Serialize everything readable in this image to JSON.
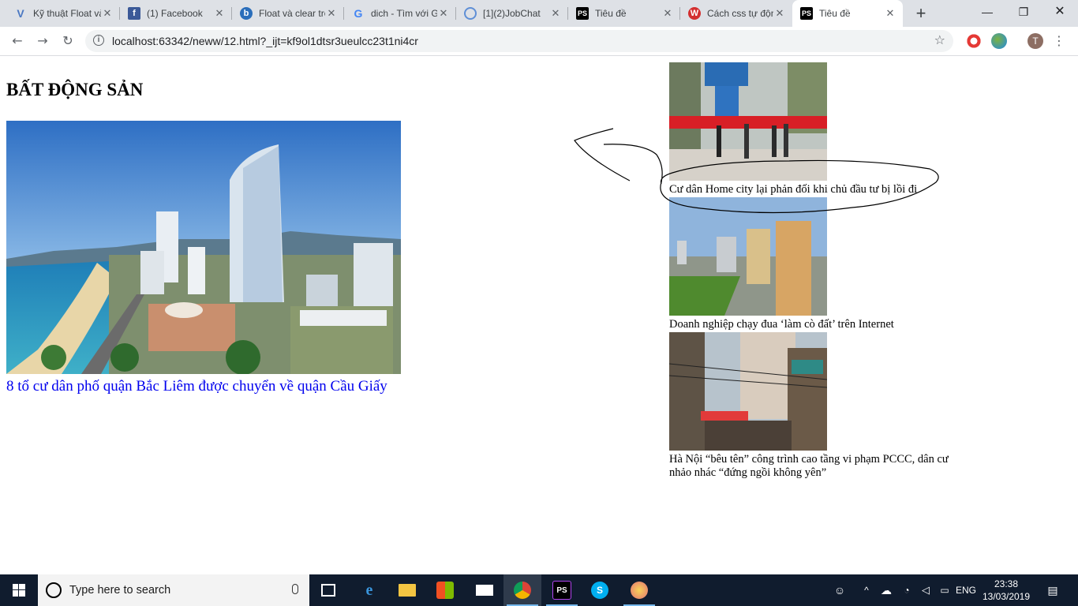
{
  "browser": {
    "tabs": [
      {
        "title": "Kỹ thuật Float và clear",
        "icon": "v-icon",
        "color": "#4a78c2"
      },
      {
        "title": "(1) Facebook",
        "icon": "facebook-icon",
        "color": "#3b5998"
      },
      {
        "title": "Float và clear trong CSS",
        "icon": "bing-icon",
        "color": "#2a6ebb"
      },
      {
        "title": "dich - Tìm với Google",
        "icon": "google-icon",
        "color": "#4285f4"
      },
      {
        "title": "[1](2)JobChat",
        "icon": "jobchat-icon",
        "color": "#5f8fd6"
      },
      {
        "title": "Tiêu đề",
        "icon": "phpstorm-icon",
        "color": "#000000"
      },
      {
        "title": "Cách css tự động",
        "icon": "w-icon",
        "color": "#d32f2f"
      },
      {
        "title": "Tiêu đề",
        "icon": "phpstorm-icon",
        "color": "#000000",
        "active": true
      }
    ],
    "new_tab": "+",
    "url": "localhost:63342/neww/12.html?_ijt=kf9ol1dtsr3ueulcc23t1ni4cr",
    "profile_initial": "T"
  },
  "page": {
    "section_title": "BẤT ĐỘNG SẢN",
    "main_article": {
      "title": "8 tổ cư dân phố quận Bắc Liêm được chuyển về quận Cầu Giấy",
      "image": "city-coastline-photo"
    },
    "side_articles": [
      {
        "title": "Cư dân Home city lại phản đối khi chủ đầu tư bị lồi đi",
        "image": "protest-banner-photo"
      },
      {
        "title": "Doanh nghiệp chạy đua ‘làm cò đất’ trên Internet",
        "image": "apartment-towers-photo"
      },
      {
        "title": "Hà Nội “bêu tên” công trình cao tầng vi phạm PCCC, dân cư nhảo nhác “đứng ngồi không yên”",
        "image": "street-buildings-photo"
      }
    ]
  },
  "taskbar": {
    "search_placeholder": "Type here to search",
    "language": "ENG",
    "time": "23:38",
    "date": "13/03/2019",
    "apps": [
      "task-view-icon",
      "edge-icon",
      "file-explorer-icon",
      "store-icon",
      "mail-icon",
      "chrome-icon",
      "phpstorm-icon",
      "skype-icon",
      "paint-icon"
    ]
  }
}
